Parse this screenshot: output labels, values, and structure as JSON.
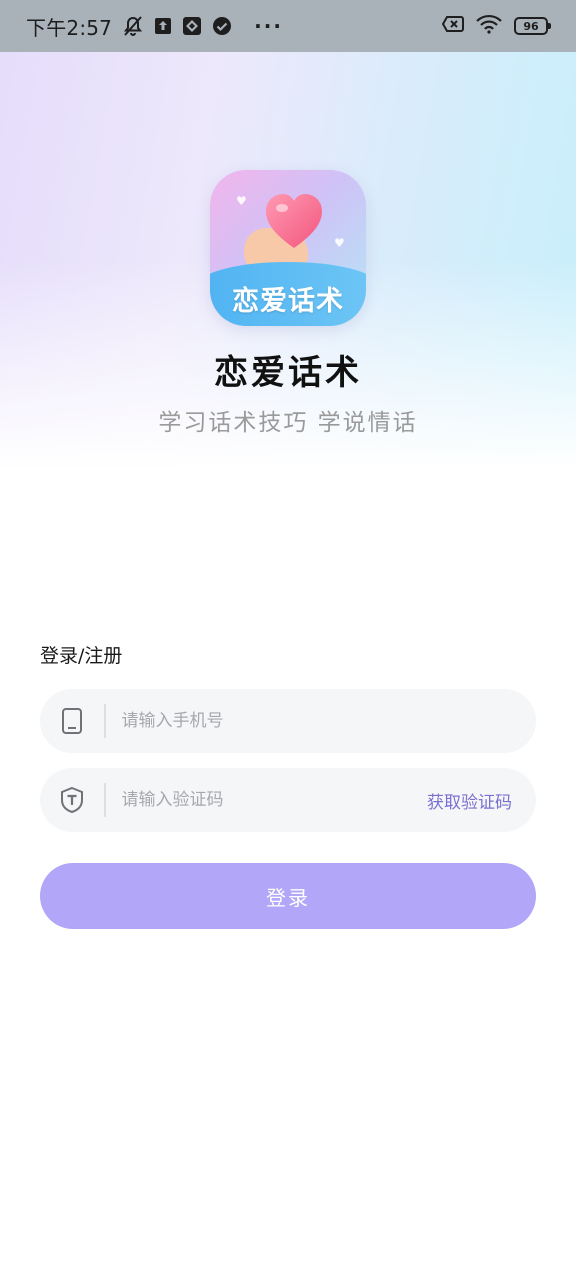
{
  "status_bar": {
    "time": "下午2:57",
    "battery": "96",
    "icons_left": [
      "mute-bell-icon",
      "upload-icon",
      "app-icon",
      "check-icon"
    ],
    "more": "···",
    "icons_right": [
      "no-sim-icon",
      "wifi-icon",
      "battery-icon"
    ]
  },
  "app": {
    "logo_text": "恋爱话术",
    "name": "恋爱话术",
    "slogan": "学习话术技巧 学说情话"
  },
  "form": {
    "title": "登录/注册",
    "phone": {
      "placeholder": "请输入手机号",
      "value": "",
      "icon": "phone-icon"
    },
    "code": {
      "placeholder": "请输入验证码",
      "value": "",
      "icon": "shield-icon",
      "get_code_label": "获取验证码"
    },
    "login_label": "登录"
  },
  "colors": {
    "primary_button": "#b1a6f7",
    "link": "#7b6fd0",
    "field_bg": "#f4f6f8",
    "status_bar_bg": "#a9b1b9"
  }
}
